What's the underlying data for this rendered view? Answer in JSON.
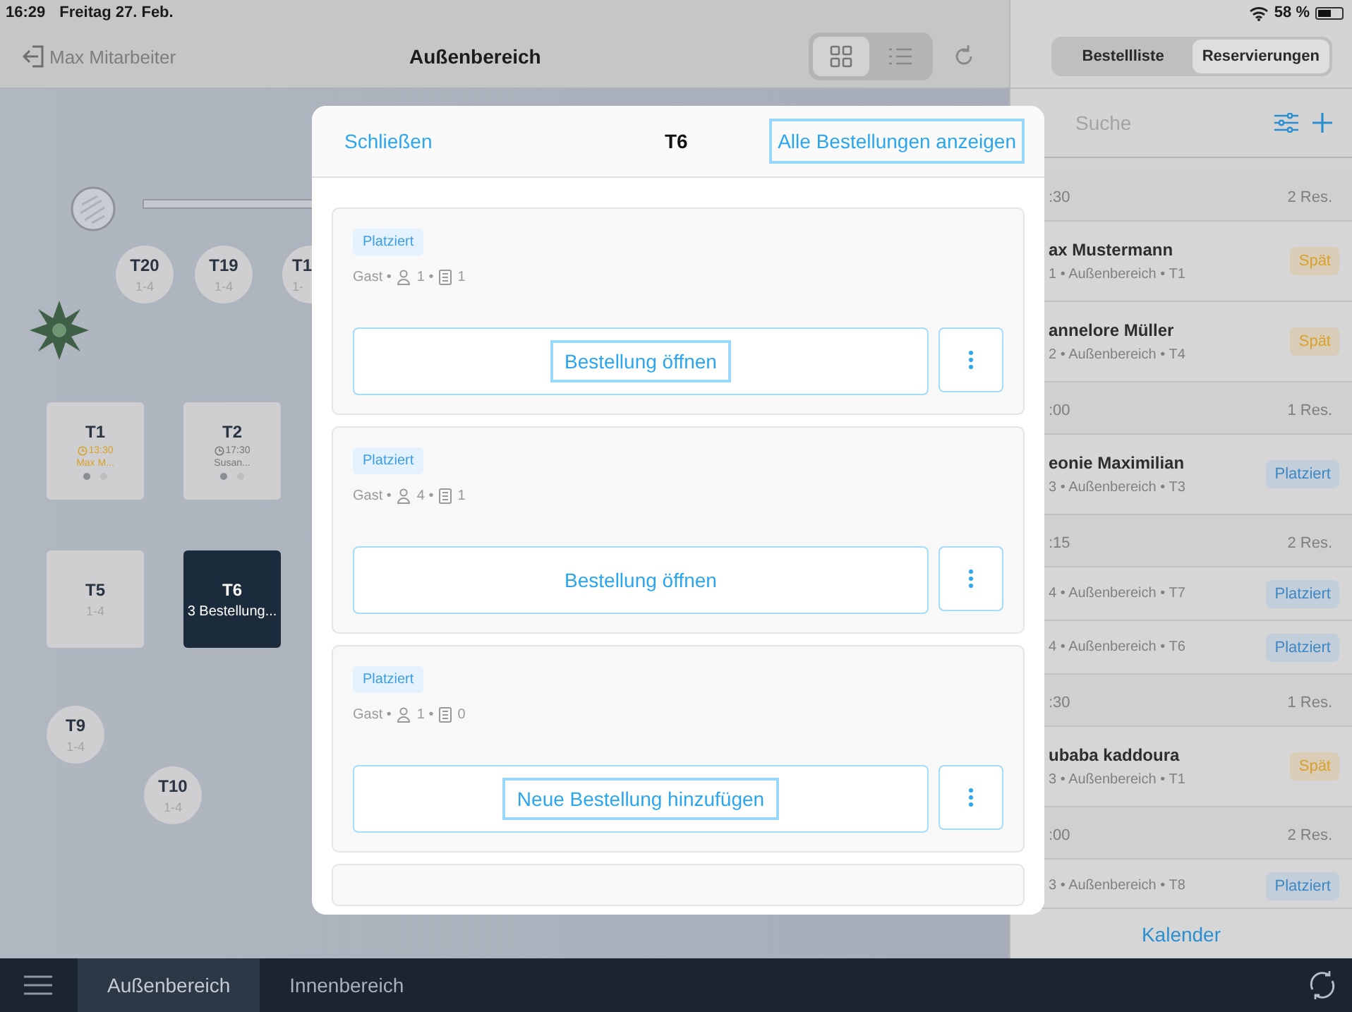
{
  "status_bar": {
    "time": "16:29",
    "date": "Freitag 27. Feb.",
    "battery": "58 %"
  },
  "nav": {
    "back": "Max Mitarbeiter",
    "title": "Außenbereich",
    "views": [
      {
        "kind": "grid",
        "selected": true
      },
      {
        "kind": "list",
        "selected": false
      }
    ]
  },
  "floor": {
    "tables": [
      {
        "kind": "round",
        "label": "T20",
        "seats": "1-4",
        "selected": false
      },
      {
        "kind": "round",
        "label": "T19",
        "seats": "1-4",
        "selected": false
      },
      {
        "kind": "round",
        "label": "T1",
        "seats": "1-",
        "selected": false
      },
      {
        "kind": "square",
        "label": "T1",
        "time": "13:30",
        "guest": "Max M...",
        "late": true,
        "dots": [
          {
            "selected": true
          },
          {
            "selected": false
          }
        ],
        "selected": false
      },
      {
        "kind": "square",
        "label": "T2",
        "time": "17:30",
        "guest": "Susan...",
        "late": false,
        "dots": [
          {
            "selected": true
          },
          {
            "selected": false
          }
        ],
        "selected": false
      },
      {
        "kind": "square",
        "label": "T5",
        "seats": "1-4",
        "selected": false
      },
      {
        "kind": "square",
        "label": "T6",
        "seats": "3 Bestellung...",
        "selected": true
      },
      {
        "kind": "round",
        "label": "T9",
        "seats": "1-4",
        "selected": false
      },
      {
        "kind": "round",
        "label": "T10",
        "seats": "1-4",
        "selected": false
      }
    ]
  },
  "modal": {
    "close": "Schließen",
    "title": "T6",
    "show_all": "Alle Bestellungen anzeigen",
    "show_all_focused": true,
    "orders": [
      {
        "status": "Platziert",
        "guest": "Gast •",
        "persons": "1 •",
        "items": "1",
        "action": "Bestellung öffnen",
        "focused": true
      },
      {
        "status": "Platziert",
        "guest": "Gast •",
        "persons": "4 •",
        "items": "1",
        "action": "Bestellung öffnen",
        "focused": false
      },
      {
        "status": "Platziert",
        "guest": "Gast •",
        "persons": "1 •",
        "items": "0",
        "action": "Neue Bestellung hinzufügen",
        "focused": true
      }
    ]
  },
  "sidebar": {
    "segments": [
      {
        "label": "Bestellliste",
        "selected": false
      },
      {
        "label": "Reservierungen",
        "selected": true
      }
    ],
    "search": {
      "placeholder": "Suche"
    },
    "groups": [
      {
        "time": ":30",
        "count": "2 Res.",
        "rows": [
          {
            "name": "ax Mustermann",
            "detail": "1 • Außenbereich • T1",
            "status": "Spät",
            "kind": "late"
          },
          {
            "name": "annelore Müller",
            "detail": "2 • Außenbereich • T4",
            "status": "Spät",
            "kind": "late"
          }
        ]
      },
      {
        "time": ":00",
        "count": "1 Res.",
        "rows": [
          {
            "name": "eonie Maximilian",
            "detail": "3 • Außenbereich • T3",
            "status": "Platziert",
            "kind": "placed"
          }
        ]
      },
      {
        "time": ":15",
        "count": "2 Res.",
        "rows": [
          {
            "detail": "4 • Außenbereich • T7",
            "status": "Platziert",
            "kind": "placed"
          },
          {
            "detail": "4 • Außenbereich • T6",
            "status": "Platziert",
            "kind": "placed"
          }
        ]
      },
      {
        "time": ":30",
        "count": "1 Res.",
        "rows": [
          {
            "name": "ubaba kaddoura",
            "detail": "3 • Außenbereich • T1",
            "status": "Spät",
            "kind": "late"
          }
        ]
      },
      {
        "time": ":00",
        "count": "2 Res.",
        "rows": [
          {
            "detail": "3 • Außenbereich • T8",
            "status": "Platziert",
            "kind": "placed"
          }
        ]
      }
    ],
    "calendar": "Kalender"
  },
  "bottom_bar": {
    "tabs": [
      {
        "label": "Außenbereich",
        "selected": true
      },
      {
        "label": "Innenbereich",
        "selected": false
      }
    ]
  }
}
